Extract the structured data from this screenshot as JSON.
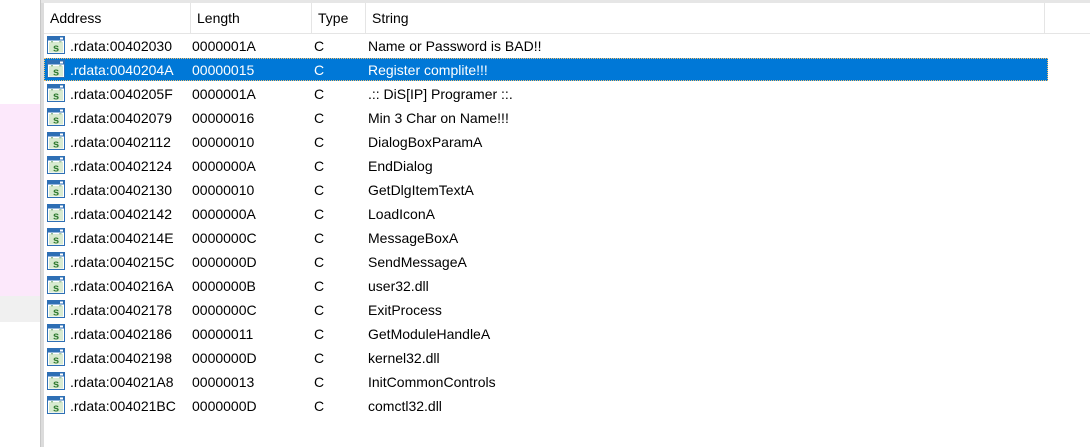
{
  "columns": {
    "address": "Address",
    "length": "Length",
    "type": "Type",
    "string": "String"
  },
  "colors": {
    "selection": "#0078d7",
    "icon_accent": "#2e6fb5"
  },
  "row_icon": "string-s-icon",
  "rows": [
    {
      "address": ".rdata:00402030",
      "length": "0000001A",
      "type": "C",
      "string": "Name or Password is BAD!!"
    },
    {
      "address": ".rdata:0040204A",
      "length": "00000015",
      "type": "C",
      "string": "Register complite!!!",
      "selected": true
    },
    {
      "address": ".rdata:0040205F",
      "length": "0000001A",
      "type": "C",
      "string": ".:: DiS[IP] Programer ::."
    },
    {
      "address": ".rdata:00402079",
      "length": "00000016",
      "type": "C",
      "string": "Min 3 Char on Name!!!"
    },
    {
      "address": ".rdata:00402112",
      "length": "00000010",
      "type": "C",
      "string": "DialogBoxParamA"
    },
    {
      "address": ".rdata:00402124",
      "length": "0000000A",
      "type": "C",
      "string": "EndDialog"
    },
    {
      "address": ".rdata:00402130",
      "length": "00000010",
      "type": "C",
      "string": "GetDlgItemTextA"
    },
    {
      "address": ".rdata:00402142",
      "length": "0000000A",
      "type": "C",
      "string": "LoadIconA"
    },
    {
      "address": ".rdata:0040214E",
      "length": "0000000C",
      "type": "C",
      "string": "MessageBoxA"
    },
    {
      "address": ".rdata:0040215C",
      "length": "0000000D",
      "type": "C",
      "string": "SendMessageA"
    },
    {
      "address": ".rdata:0040216A",
      "length": "0000000B",
      "type": "C",
      "string": "user32.dll"
    },
    {
      "address": ".rdata:00402178",
      "length": "0000000C",
      "type": "C",
      "string": "ExitProcess"
    },
    {
      "address": ".rdata:00402186",
      "length": "00000011",
      "type": "C",
      "string": "GetModuleHandleA"
    },
    {
      "address": ".rdata:00402198",
      "length": "0000000D",
      "type": "C",
      "string": "kernel32.dll"
    },
    {
      "address": ".rdata:004021A8",
      "length": "00000013",
      "type": "C",
      "string": "InitCommonControls"
    },
    {
      "address": ".rdata:004021BC",
      "length": "0000000D",
      "type": "C",
      "string": "comctl32.dll"
    }
  ]
}
